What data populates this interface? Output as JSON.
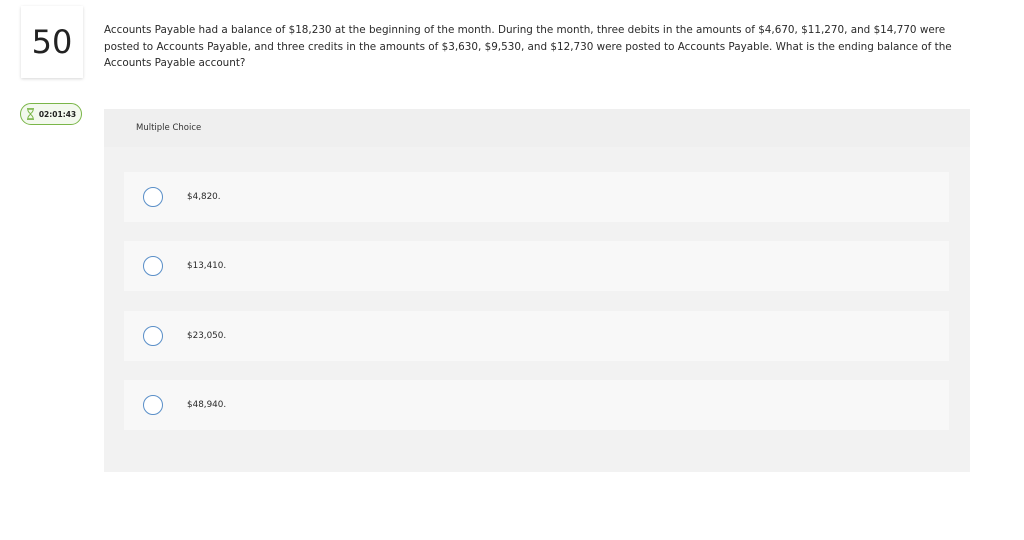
{
  "question": {
    "number": "50",
    "timer": "02:01:43",
    "text": "Accounts Payable had a balance of $18,230 at the beginning of the month. During the month, three debits in the amounts of $4,670, $11,270, and $14,770 were posted to Accounts Payable, and three credits in the amounts of $3,630, $9,530, and $12,730 were posted to Accounts Payable. What is the ending balance of the Accounts Payable account?"
  },
  "multiple_choice": {
    "header": "Multiple Choice",
    "options": [
      {
        "label": "$4,820."
      },
      {
        "label": "$13,410."
      },
      {
        "label": "$23,050."
      },
      {
        "label": "$48,940."
      }
    ]
  },
  "icons": {
    "timer": "hourglass-icon",
    "option": "radio-icon"
  },
  "colors": {
    "timer_border": "#7ab648",
    "radio_border": "#5a8fc8",
    "panel_bg": "#f2f2f2",
    "choice_bg": "#f8f8f8"
  }
}
